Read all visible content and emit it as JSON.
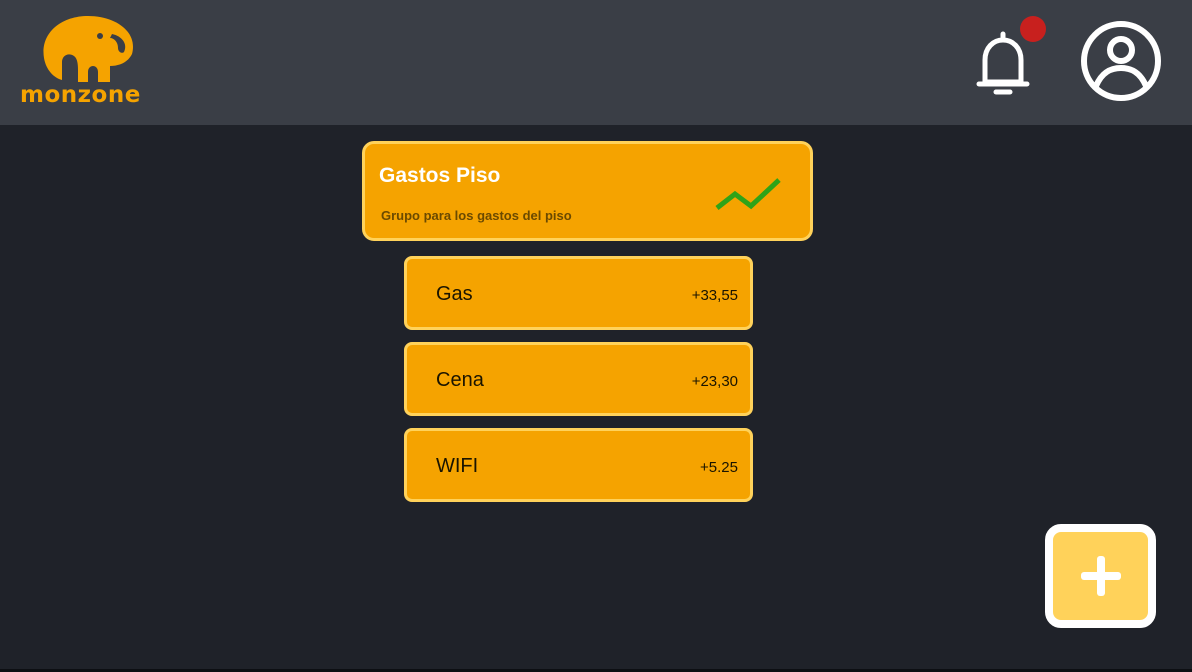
{
  "header": {
    "logo_text": "monzone",
    "notification_dot": true,
    "colors": {
      "background": "#3a3e46",
      "brand": "#f5a300",
      "notification": "#c8201e"
    }
  },
  "group": {
    "title": "Gastos Piso",
    "subtitle": "Grupo para los gastos del piso",
    "trend_icon": "trend-up-icon",
    "trend_color": "#2fa318"
  },
  "expenses": [
    {
      "name": "Gas",
      "amount": "+33,55"
    },
    {
      "name": "Cena",
      "amount": "+23,30"
    },
    {
      "name": "WIFI",
      "amount": "+5.25"
    }
  ],
  "fab": {
    "icon": "plus-icon"
  },
  "colors": {
    "app_background": "#1f2229",
    "card": "#f5a300",
    "card_border": "#ffd25a"
  }
}
